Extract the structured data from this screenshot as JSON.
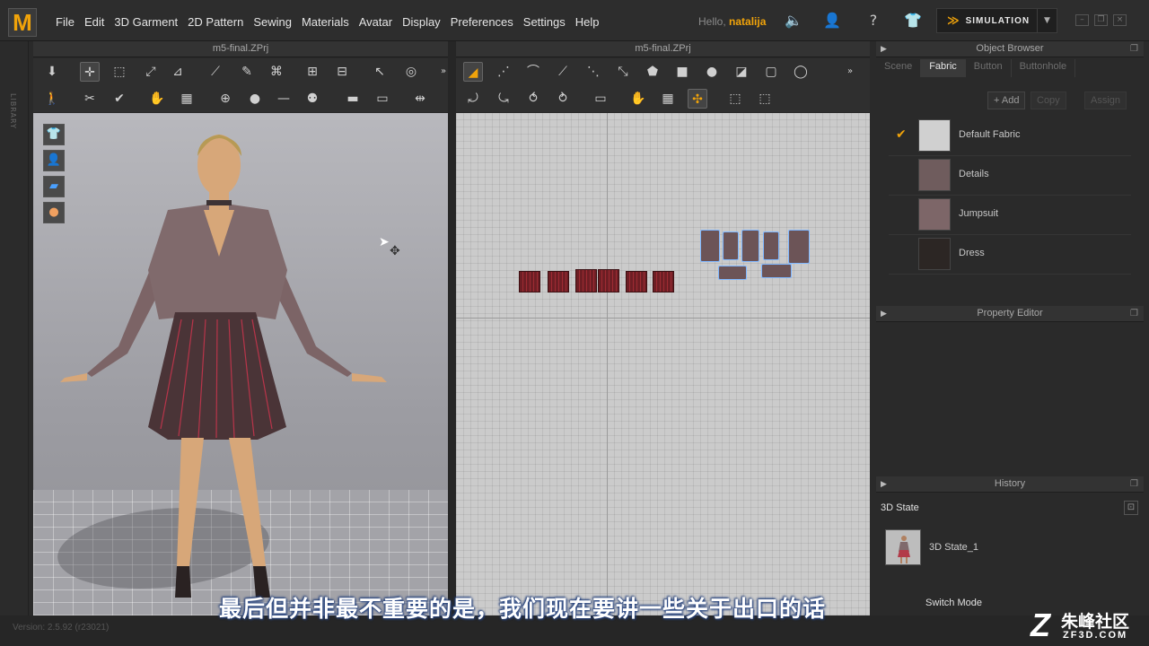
{
  "app": {
    "logo_letter": "M",
    "menu": [
      "File",
      "Edit",
      "3D Garment",
      "2D Pattern",
      "Sewing",
      "Materials",
      "Avatar",
      "Display",
      "Preferences",
      "Settings",
      "Help"
    ],
    "hello_prefix": "Hello,",
    "username": "natalija",
    "mode_button": "SIMULATION",
    "library_label": "LIBRARY",
    "accent": "#f0a30a"
  },
  "window3d": {
    "title": "m5-final.ZPrj"
  },
  "window2d": {
    "title": "m5-final.ZPrj"
  },
  "object_browser": {
    "title": "Object Browser",
    "tabs": [
      "Scene",
      "Fabric",
      "Button",
      "Buttonhole"
    ],
    "active_tab": "Fabric",
    "add_label": "+ Add",
    "copy_label": "Copy",
    "assign_label": "Assign",
    "fabrics": [
      {
        "name": "Default Fabric",
        "swatch": "#d0d0d0",
        "checked": true
      },
      {
        "name": "Details",
        "swatch": "#6f5c5d",
        "checked": false
      },
      {
        "name": "Jumpsuit",
        "swatch": "#7d6668",
        "checked": false
      },
      {
        "name": "Dress",
        "swatch": "#2c2624",
        "checked": false
      }
    ]
  },
  "property_editor": {
    "title": "Property Editor"
  },
  "history": {
    "title": "History",
    "state_label": "3D State",
    "item": "3D State_1",
    "switch_mode": "Switch Mode"
  },
  "status": {
    "version": "Version: 2.5.92    (r23021)"
  },
  "subtitle": "最后但并非最不重要的是，我们现在要讲一些关于出口的话",
  "watermark": {
    "cn": "朱峰社区",
    "en": "ZF3D.COM"
  }
}
